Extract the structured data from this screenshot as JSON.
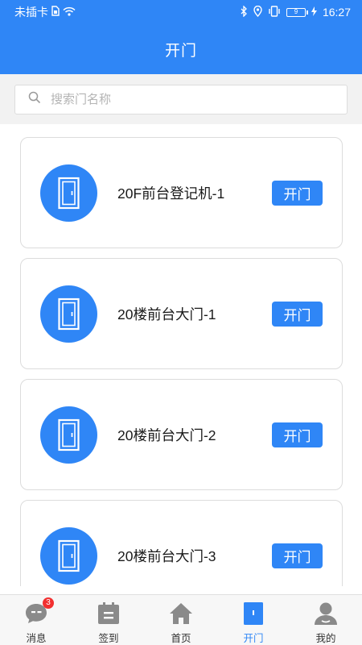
{
  "status_bar": {
    "carrier": "未插卡",
    "battery_level": "9",
    "time": "16:27"
  },
  "header": {
    "title": "开门"
  },
  "search": {
    "placeholder": "搜索门名称"
  },
  "doors": [
    {
      "name": "20F前台登记机-1",
      "button_label": "开门"
    },
    {
      "name": "20楼前台大门-1",
      "button_label": "开门"
    },
    {
      "name": "20楼前台大门-2",
      "button_label": "开门"
    },
    {
      "name": "20楼前台大门-3",
      "button_label": "开门"
    }
  ],
  "tabbar": {
    "items": [
      {
        "label": "消息",
        "icon": "message-icon",
        "badge": "3"
      },
      {
        "label": "签到",
        "icon": "calendar-icon"
      },
      {
        "label": "首页",
        "icon": "home-icon"
      },
      {
        "label": "开门",
        "icon": "door-icon",
        "active": true
      },
      {
        "label": "我的",
        "icon": "profile-icon"
      }
    ]
  },
  "colors": {
    "primary": "#2f86f6",
    "badge": "#f23030",
    "inactive_icon": "#8a8a8a"
  }
}
